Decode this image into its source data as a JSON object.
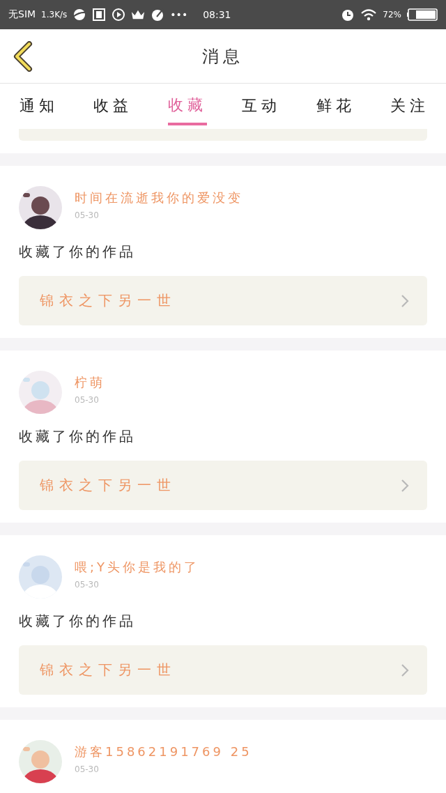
{
  "status_bar": {
    "carrier": "无SIM",
    "speed": "1.3K/s",
    "more": "•••",
    "time": "08:31",
    "battery": "72%"
  },
  "header": {
    "title": "消息"
  },
  "tabs": [
    {
      "label": "通知",
      "selected": false
    },
    {
      "label": "收益",
      "selected": false
    },
    {
      "label": "收藏",
      "selected": true
    },
    {
      "label": "互动",
      "selected": false
    },
    {
      "label": "鲜花",
      "selected": false
    },
    {
      "label": "关注",
      "selected": false
    }
  ],
  "messages": [
    {
      "name": "时间在流逝我你的爱没变",
      "date": "05-30",
      "text": "收藏了你的作品",
      "work": "锦衣之下另一世"
    },
    {
      "name": "柠萌",
      "date": "05-30",
      "text": "收藏了你的作品",
      "work": "锦衣之下另一世"
    },
    {
      "name": "喂;Y头你是我的了",
      "date": "05-30",
      "text": "收藏了你的作品",
      "work": "锦衣之下另一世"
    },
    {
      "name": "游客15862191769 25",
      "date": "05-30"
    }
  ]
}
